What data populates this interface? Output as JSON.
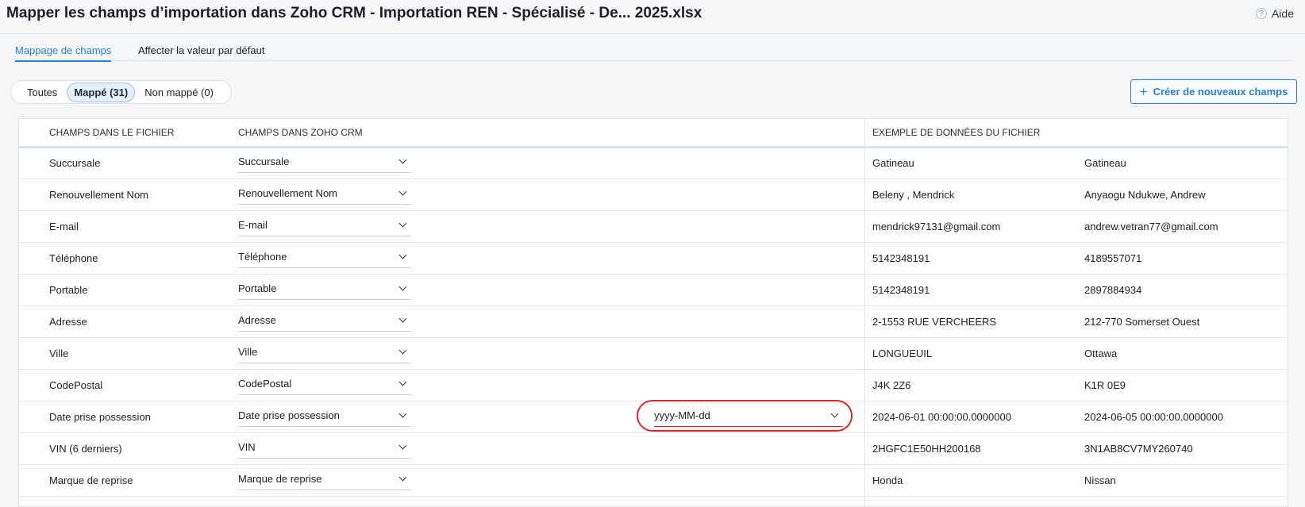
{
  "header": {
    "title": "Mapper les champs d’importation dans Zoho CRM - Importation REN - Spécialisé - De... 2025.xlsx",
    "help_icon": "?",
    "help_label": "Aide"
  },
  "tabs": [
    {
      "label": "Mappage de champs",
      "active": true
    },
    {
      "label": "Affecter la valeur par défaut",
      "active": false
    }
  ],
  "filters": [
    {
      "label": "Toutes",
      "active": false
    },
    {
      "label": "Mappé (31)",
      "active": true
    },
    {
      "label": "Non mappé (0)",
      "active": false
    }
  ],
  "create_button": {
    "icon": "+",
    "label": "Créer de nouveaux champs"
  },
  "table": {
    "headers": {
      "file_fields": "CHAMPS DANS LE FICHIER",
      "crm_fields": "CHAMPS DANS ZOHO CRM",
      "sample_data": "EXEMPLE DE DONNÉES DU FICHIER"
    },
    "rows": [
      {
        "file": "Succursale",
        "crm": "Succursale",
        "s1": "Gatineau",
        "s2": "Gatineau"
      },
      {
        "file": "Renouvellement Nom",
        "crm": "Renouvellement Nom",
        "s1": "Beleny , Mendrick",
        "s2": "Anyaogu Ndukwe, Andrew"
      },
      {
        "file": "E-mail",
        "crm": "E-mail",
        "s1": "mendrick97131@gmail.com",
        "s2": "andrew.vetran77@gmail.com"
      },
      {
        "file": "Téléphone",
        "crm": "Téléphone",
        "s1": "5142348191",
        "s2": "4189557071"
      },
      {
        "file": "Portable",
        "crm": "Portable",
        "s1": "5142348191",
        "s2": "2897884934"
      },
      {
        "file": "Adresse",
        "crm": "Adresse",
        "s1": "2-1553 RUE VERCHEERS",
        "s2": "212-770 Somerset Ouest"
      },
      {
        "file": "Ville",
        "crm": "Ville",
        "s1": "LONGUEUIL",
        "s2": "Ottawa"
      },
      {
        "file": "CodePostal",
        "crm": "CodePostal",
        "s1": "J4K 2Z6",
        "s2": "K1R 0E9"
      },
      {
        "file": "Date prise possession",
        "crm": "Date prise possession",
        "date_format": "yyyy-MM-dd",
        "s1": "2024-06-01 00:00:00.0000000",
        "s2": "2024-06-05 00:00:00.0000000"
      },
      {
        "file": "VIN (6 derniers)",
        "crm": "VIN",
        "s1": "2HGFC1E50HH200168",
        "s2": "3N1AB8CV7MY260740"
      },
      {
        "file": "Marque de reprise",
        "crm": "Marque de reprise",
        "s1": "Honda",
        "s2": "Nissan"
      }
    ]
  },
  "colors": {
    "accent": "#2b7fd6",
    "highlight": "#e02424"
  }
}
